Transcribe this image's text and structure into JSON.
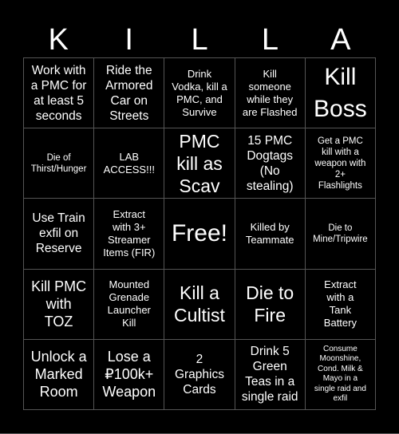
{
  "card": {
    "title_letters": [
      "K",
      "I",
      "L",
      "L",
      "A"
    ],
    "colors": {
      "background": "#000000",
      "text": "#ffffff",
      "grid_line": "#555555"
    },
    "rows": [
      [
        {
          "text": "Work with\na PMC for\nat least 5\nseconds",
          "size": "m"
        },
        {
          "text": "Ride the\nArmored\nCar on\nStreets",
          "size": "m"
        },
        {
          "text": "Drink\nVodka, kill a\nPMC, and\nSurvive",
          "size": "s"
        },
        {
          "text": "Kill\nsomeone\nwhile they\nare Flashed",
          "size": "s"
        },
        {
          "text": "Kill\nBoss",
          "size": "xl"
        }
      ],
      [
        {
          "text": "Die of\nThirst/Hunger",
          "size": "xs"
        },
        {
          "text": "LAB\nACCESS!!!",
          "size": "s"
        },
        {
          "text": "PMC\nkill as\nScav",
          "size": "l"
        },
        {
          "text": "15 PMC\nDogtags\n(No\nstealing)",
          "size": "m"
        },
        {
          "text": "Get a PMC\nkill with a\nweapon with\n2+\nFlashlights",
          "size": "xs"
        }
      ],
      [
        {
          "text": "Use Train\nexfil on\nReserve",
          "size": "m"
        },
        {
          "text": "Extract\nwith 3+\nStreamer\nItems (FIR)",
          "size": "s"
        },
        {
          "text": "Free!",
          "size": "xl"
        },
        {
          "text": "Killed by\nTeammate",
          "size": "s"
        },
        {
          "text": "Die to\nMine/Tripwire",
          "size": "xs"
        }
      ],
      [
        {
          "text": "Kill PMC\nwith\nTOZ",
          "size": "ml"
        },
        {
          "text": "Mounted\nGrenade\nLauncher\nKill",
          "size": "s"
        },
        {
          "text": "Kill a\nCultist",
          "size": "l"
        },
        {
          "text": "Die to\nFire",
          "size": "l"
        },
        {
          "text": "Extract\nwith a\nTank\nBattery",
          "size": "s"
        }
      ],
      [
        {
          "text": "Unlock a\nMarked\nRoom",
          "size": "ml"
        },
        {
          "text": "Lose a\n₽100k+\nWeapon",
          "size": "ml"
        },
        {
          "text": "2\nGraphics\nCards",
          "size": "m"
        },
        {
          "text": "Drink 5\nGreen\nTeas in a\nsingle raid",
          "size": "m"
        },
        {
          "text": "Consume\nMoonshine,\nCond. Milk &\nMayo in a\nsingle raid and\nexfil",
          "size": "xxs"
        }
      ]
    ]
  }
}
